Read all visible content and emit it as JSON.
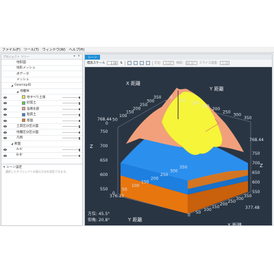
{
  "menu": [
    "ファイル(F)",
    "ツール(T)",
    "ウィンドウ(W)",
    "ヘルプ(H)"
  ],
  "project_panel": {
    "title": "プロジェクト ツリー",
    "controls": "▾ ✕",
    "items": [
      {
        "label": "地形図",
        "level": 2
      },
      {
        "label": "地形メッシュ",
        "level": 2
      },
      {
        "label": "点データ",
        "level": 2
      },
      {
        "label": "メッシュ",
        "level": 2
      },
      {
        "label": "GeomapID",
        "level": 1,
        "expanded": true
      },
      {
        "label": "地層体",
        "level": 2,
        "expanded": true
      },
      {
        "label": "地すべり土塊",
        "level": 3,
        "color": "#f5f53c",
        "visible": true
      },
      {
        "label": "砂質土",
        "level": 3,
        "color": "#49d24a",
        "visible": true
      },
      {
        "label": "強風化部",
        "level": 3,
        "color": "#f2a07c",
        "visible": true
      },
      {
        "label": "粘質土",
        "level": 3,
        "color": "#1f86e8",
        "visible": true
      },
      {
        "label": "基盤",
        "level": 3,
        "color": "#f07b12",
        "visible": true
      },
      {
        "label": "土質区分区分図",
        "level": 2,
        "visible": true
      },
      {
        "label": "地層区分区分図",
        "level": 2,
        "visible": true
      },
      {
        "label": "凡例",
        "level": 2,
        "visible": true
      },
      {
        "label": "断面",
        "level": 1,
        "expanded": true
      },
      {
        "label": "A-A'",
        "level": 2,
        "visible": true
      },
      {
        "label": "B-B'",
        "level": 2,
        "visible": true
      }
    ]
  },
  "scene_settings": {
    "title": "シーン設定",
    "hint": "選択したオブジェクトの表示方法を設定できます。"
  },
  "scene_tab": "シーン",
  "toolbar": {
    "scale_label": "標高スケール",
    "scale_value": "1.00",
    "azimuth_label": "方位:",
    "azimuth_value": "0.00°",
    "tilt_label": "傾斜:",
    "tilt_value": "90.00°",
    "speed_label": "スライス速度:",
    "speed_value": "1.00"
  },
  "chart_data": {
    "type": "3d-surface",
    "x_axis_label": "X 距離",
    "y_axis_label": "Y 距離",
    "z_axis_label": "Z",
    "x_ticks": [
      "0",
      "50",
      "100",
      "150",
      "200",
      "250",
      "300",
      "350"
    ],
    "y_ticks": [
      "0",
      "50",
      "100",
      "150",
      "200",
      "250",
      "300",
      "350"
    ],
    "z_ticks": [
      "550",
      "600",
      "650",
      "700",
      "750"
    ],
    "corner_labels": [
      "376.13",
      "768.44",
      "377.48"
    ],
    "layers": [
      {
        "name": "地すべり土塊",
        "color": "#f5f53c"
      },
      {
        "name": "強風化部",
        "color": "#f2a07c"
      },
      {
        "name": "粘質土",
        "color": "#1f86e8"
      },
      {
        "name": "基盤",
        "color": "#f07b12"
      }
    ]
  },
  "status": {
    "azimuth": "方位: 45.5°",
    "elevation": "仰角: 20.8°"
  }
}
